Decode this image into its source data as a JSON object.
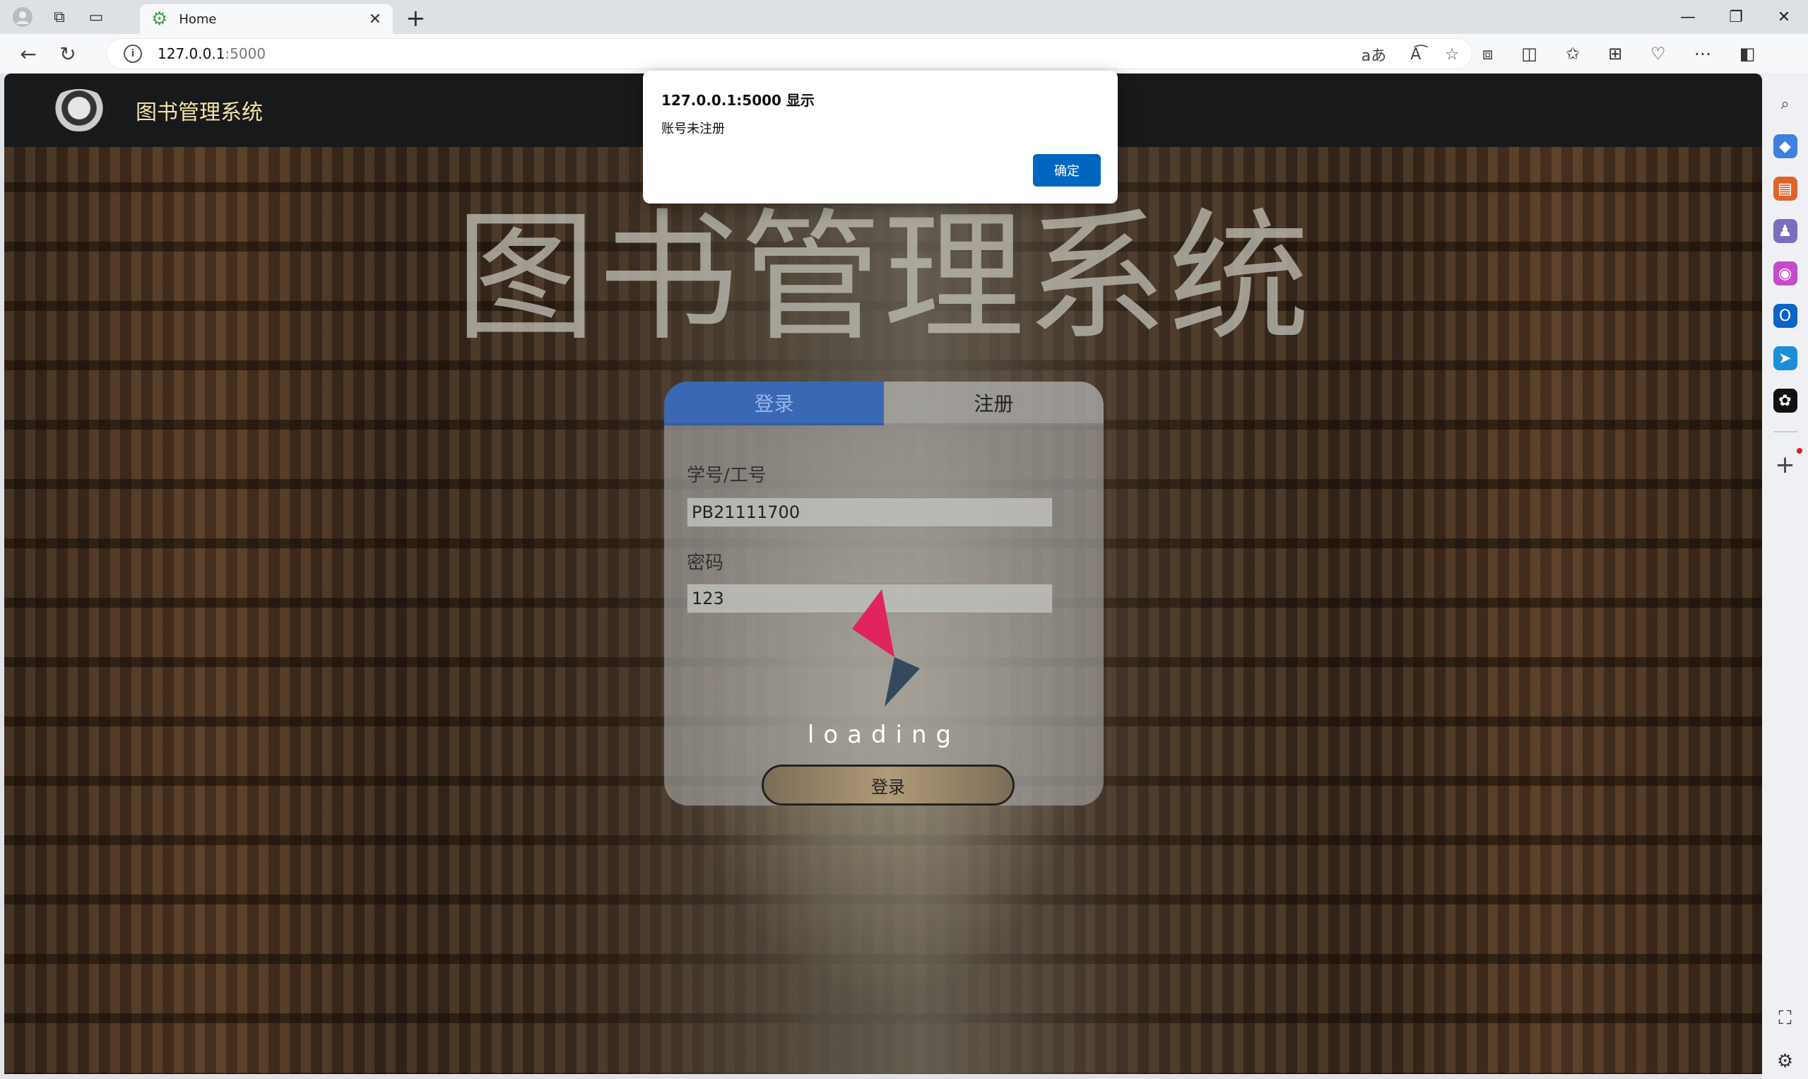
{
  "browser": {
    "tab_title": "Home",
    "tab_close": "✕",
    "new_tab": "+",
    "url_host": "127.0.0.1",
    "url_port": ":5000",
    "window_minimize": "—",
    "window_restore": "❐",
    "window_close": "✕"
  },
  "page": {
    "site_name": "图书管理系统",
    "hero_title": "图书管理系统"
  },
  "login": {
    "tab_login": "登录",
    "tab_register": "注册",
    "id_label": "学号/工号",
    "id_value": "PB21111700",
    "password_label": "密码",
    "password_value": "123",
    "loading_text": "loading",
    "submit_label": "登录"
  },
  "dialog": {
    "title": "127.0.0.1:5000 显示",
    "message": "账号未注册",
    "ok_label": "确定"
  },
  "colors": {
    "dialog_button": "#0067c0",
    "login_tab_active": "#3a68b4",
    "site_name": "#f4e3a6",
    "loader_red": "#e0245e",
    "loader_dark": "#34495e"
  }
}
